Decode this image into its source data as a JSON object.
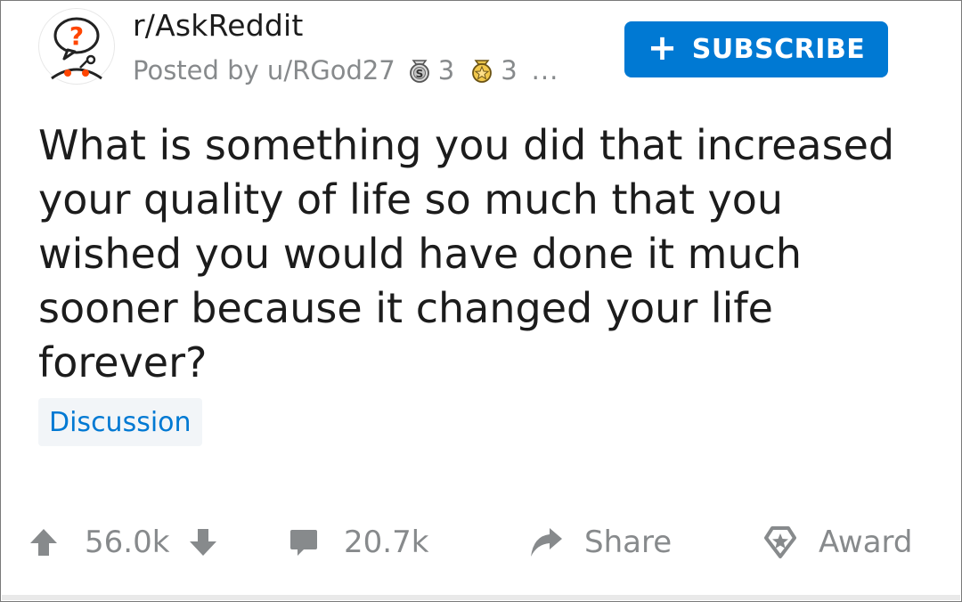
{
  "post": {
    "subreddit": "r/AskReddit",
    "posted_by": "Posted by u/RGod27",
    "awards": [
      {
        "icon": "silver-award-icon",
        "count": "3"
      },
      {
        "icon": "gold-award-icon",
        "count": "3"
      }
    ],
    "more": "...",
    "title": "What is something you did that increased your quality of life so much that you wished you would have done it much sooner because it changed your life forever?",
    "flair": "Discussion"
  },
  "subscribe": {
    "label": "SUBSCRIBE",
    "icon": "plus-icon"
  },
  "actions": {
    "upvotes": "56.0k",
    "comments": "20.7k",
    "share": "Share",
    "award": "Award"
  },
  "colors": {
    "accent": "#0079d3",
    "text": "#1c1c1c",
    "meta": "#878a8c",
    "flair_bg": "#f2f5f8",
    "snoo_accent": "#ff4500"
  }
}
